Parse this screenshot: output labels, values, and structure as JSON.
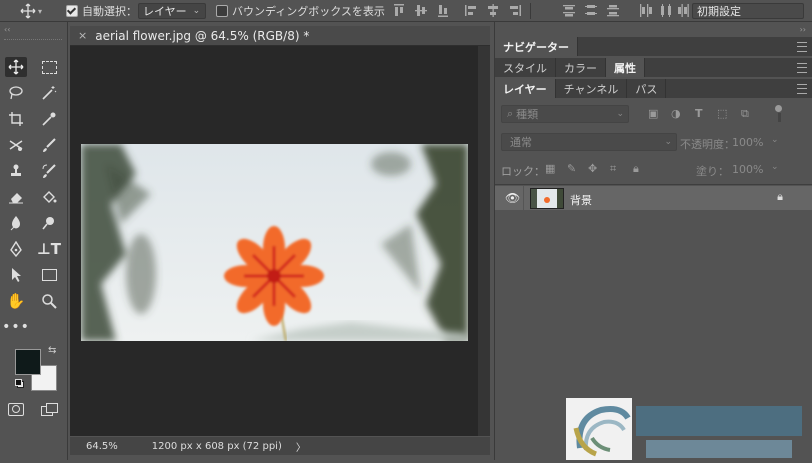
{
  "options_bar": {
    "move_icon": "move-icon",
    "auto_select_checked": true,
    "auto_select_label": "自動選択：",
    "auto_select_target": "レイヤー",
    "bounding_box_checked": false,
    "bounding_box_label": "バウンディングボックスを表示",
    "preset_label": "初期設定"
  },
  "document": {
    "tab_title": "aerial flower.jpg @ 64.5% (RGB/8) *",
    "zoom": "64.5%",
    "doc_info": "1200 px x 608 px (72 ppi)",
    "status_arrow": "〉"
  },
  "panels": {
    "navigator_tab": "ナビゲーター",
    "group2_tabs": [
      "スタイル",
      "カラー",
      "属性"
    ],
    "group2_active": "属性",
    "group3_tabs": [
      "レイヤー",
      "チャンネル",
      "パス"
    ],
    "group3_active": "レイヤー",
    "filter_placeholder": "種類",
    "blend_mode": "通常",
    "opacity_label": "不透明度：",
    "opacity_value": "100%",
    "lock_label": "ロック：",
    "fill_label": "塗り：",
    "fill_value": "100%",
    "layer_name": "背景"
  },
  "colors": {
    "foreground": "#0f1a1a",
    "background": "#f2f2f2",
    "flower": "#f26b2a"
  }
}
